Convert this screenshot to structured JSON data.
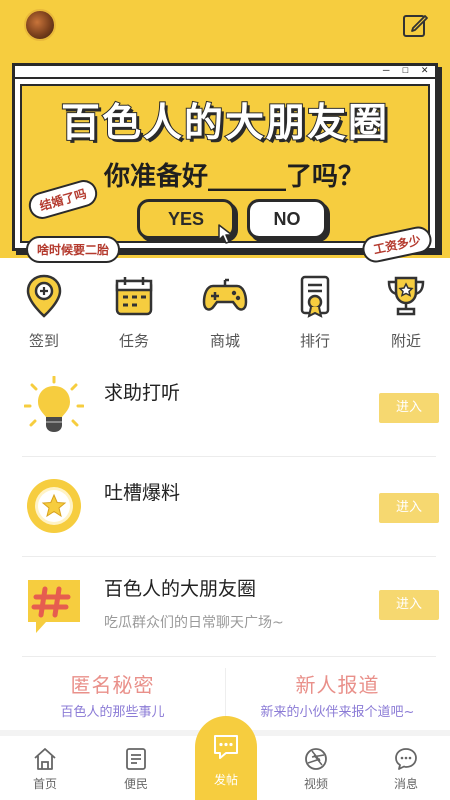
{
  "header": {
    "avatar_icon": "user-avatar",
    "edit_icon": "edit-square-icon"
  },
  "banner": {
    "window_controls": "— ☐ ✕",
    "title": "百色人的大朋友圈",
    "question": "你准备好______了吗？",
    "bubble_married": "结婚了吗",
    "bubble_kid": "啥时候要二胎",
    "bubble_salary": "工资多少",
    "yes_label": "YES",
    "no_label": "NO"
  },
  "quick_nav": [
    {
      "label": "签到",
      "icon": "location-pin-icon"
    },
    {
      "label": "任务",
      "icon": "calendar-icon"
    },
    {
      "label": "商城",
      "icon": "gamepad-icon"
    },
    {
      "label": "排行",
      "icon": "certificate-icon"
    },
    {
      "label": "附近",
      "icon": "trophy-icon"
    }
  ],
  "list": [
    {
      "title": "求助打听",
      "subtitle": "",
      "button": "进入",
      "icon": "lightbulb-icon"
    },
    {
      "title": "吐槽爆料",
      "subtitle": "",
      "button": "进入",
      "icon": "star-medal-icon"
    },
    {
      "title": "百色人的大朋友圈",
      "subtitle": "吃瓜群众们的日常聊天广场~",
      "button": "进入",
      "icon": "hashtag-icon"
    }
  ],
  "cards": [
    {
      "title": "匿名秘密",
      "subtitle": "百色人的那些事儿"
    },
    {
      "title": "新人报道",
      "subtitle": "新来的小伙伴来报个道吧~"
    }
  ],
  "tabbar": {
    "home": "首页",
    "convenience": "便民",
    "post": "发帖",
    "video": "视频",
    "messages": "消息"
  },
  "colors": {
    "accent": "#F6CD3F",
    "enter_button": "#F6D870",
    "card_title": "#E9908A",
    "card_subtitle": "#8B7BD6"
  }
}
